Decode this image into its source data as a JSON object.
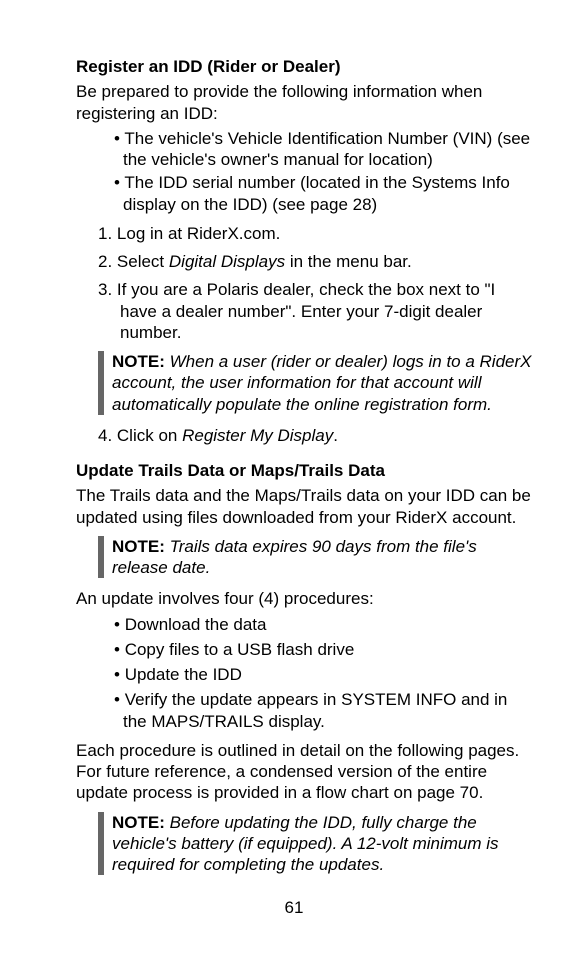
{
  "section1": {
    "heading": "Register an IDD (Rider or Dealer)",
    "intro": "Be prepared to provide the following information when registering an IDD:",
    "prepBullets": [
      "The vehicle's Vehicle Identification Number (VIN) (see the vehicle's owner's manual for location)",
      "The IDD serial number (located in the Systems Info display on the IDD) (see page 28)"
    ],
    "step1_prefix": "1.  ",
    "step1": "Log in at RiderX.com.",
    "step2_prefix": "2.  ",
    "step2_a": "Select ",
    "step2_b": "Digital Displays",
    "step2_c": " in the menu bar.",
    "step3_prefix": "3.  ",
    "step3": "If you are a Polaris dealer, check the box next to \"I have a dealer number\". Enter your 7-digit dealer number.",
    "note1_label": "NOTE: ",
    "note1_text": "When a user (rider or dealer) logs in to a RiderX account, the user information for that account will automatically populate the online registration form.",
    "step4_prefix": "4.  ",
    "step4_a": "Click on ",
    "step4_b": "Register My Display",
    "step4_c": "."
  },
  "section2": {
    "heading": "Update Trails Data or Maps/Trails Data",
    "intro": "The Trails data and the Maps/Trails data on your IDD can be updated using files downloaded from your RiderX account.",
    "note2_label": "NOTE: ",
    "note2_text": "Trails data expires 90 days from the file's release date.",
    "procIntro": "An update involves four (4) procedures:",
    "procBullets": [
      "Download the data",
      "Copy files to a USB flash drive",
      "Update the IDD",
      "Verify the update appears in SYSTEM INFO and in the MAPS/TRAILS display."
    ],
    "outro": "Each procedure is outlined in detail on the following pages. For future reference, a condensed version of the entire update process is provided in a flow chart on page 70.",
    "note3_label": "NOTE: ",
    "note3_text": "Before updating the IDD, fully charge the vehicle's battery (if equipped). A 12-volt minimum is required for completing the updates."
  },
  "pageNumber": "61"
}
